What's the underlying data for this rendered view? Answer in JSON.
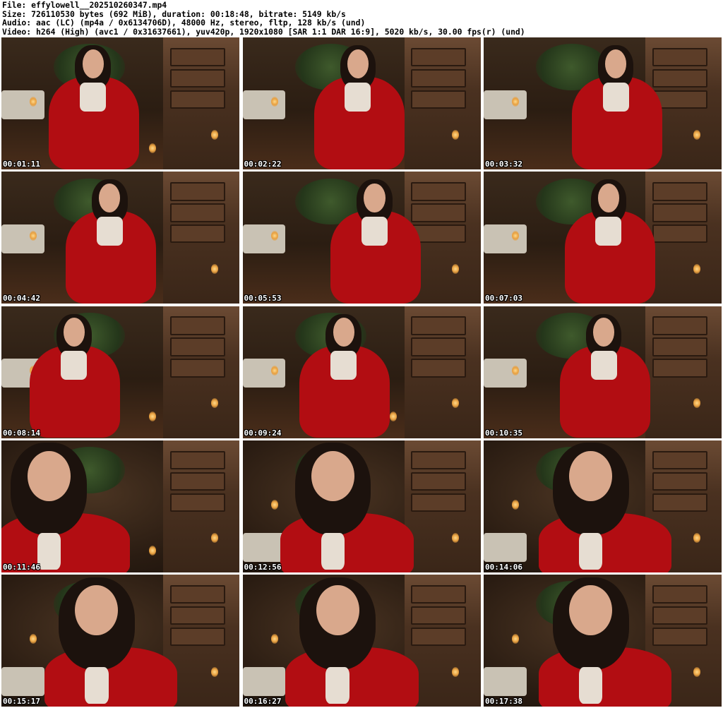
{
  "header": {
    "file_line": "File: effylowell__202510260347.mp4",
    "size_line": "Size: 726110530 bytes (692 MiB), duration: 00:18:48, bitrate: 5149 kb/s",
    "audio_line": "Audio: aac (LC) (mp4a / 0x6134706D), 48000 Hz, stereo, fltp, 128 kb/s (und)",
    "video_line": "Video: h264 (High) (avc1 / 0x31637661), yuv420p, 1920x1080 [SAR 1:1 DAR 16:9], 5020 kb/s, 30.00 fps(r) (und)"
  },
  "thumbnails": [
    {
      "timestamp": "00:01:11"
    },
    {
      "timestamp": "00:02:22"
    },
    {
      "timestamp": "00:03:32"
    },
    {
      "timestamp": "00:04:42"
    },
    {
      "timestamp": "00:05:53"
    },
    {
      "timestamp": "00:07:03"
    },
    {
      "timestamp": "00:08:14"
    },
    {
      "timestamp": "00:09:24"
    },
    {
      "timestamp": "00:10:35"
    },
    {
      "timestamp": "00:11:46"
    },
    {
      "timestamp": "00:12:56"
    },
    {
      "timestamp": "00:14:06"
    },
    {
      "timestamp": "00:15:17"
    },
    {
      "timestamp": "00:16:27"
    },
    {
      "timestamp": "00:17:38"
    }
  ],
  "colors": {
    "cape_red": "#b20d12",
    "timestamp_text": "#ffffff",
    "background": "#ffffff"
  }
}
